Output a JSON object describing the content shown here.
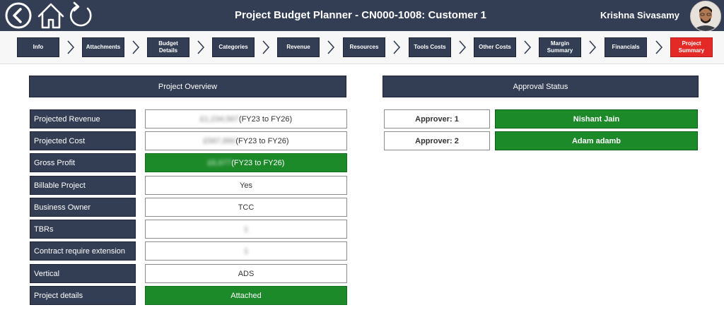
{
  "header": {
    "title": "Project Budget Planner - CN000-1008: Customer 1",
    "user_name": "Krishna Sivasamy",
    "bar_color": "#333d54"
  },
  "steps": [
    {
      "label": "Info",
      "active": false
    },
    {
      "label": "Attachments",
      "active": false
    },
    {
      "label": "Budget Details",
      "active": false
    },
    {
      "label": "Categories",
      "active": false
    },
    {
      "label": "Revenue",
      "active": false
    },
    {
      "label": "Resources",
      "active": false
    },
    {
      "label": "Tools Costs",
      "active": false
    },
    {
      "label": "Other Costs",
      "active": false
    },
    {
      "label": "Margin Summary",
      "active": false
    },
    {
      "label": "Financials",
      "active": false
    },
    {
      "label": "Project Summary",
      "active": true
    }
  ],
  "overview": {
    "header": "Project Overview",
    "rows": [
      {
        "label": "Projected Revenue",
        "value_blurred": "£1,234,567",
        "value_suffix": "(FY23 to FY26)",
        "style": "plain"
      },
      {
        "label": "Projected Cost",
        "value_blurred": "£567,890",
        "value_suffix": "(FY23 to FY26)",
        "style": "plain"
      },
      {
        "label": "Gross Profit",
        "value_blurred": "£6,677",
        "value_suffix": "(FY23 to FY26)",
        "style": "green"
      },
      {
        "label": "Billable Project",
        "value": "Yes",
        "style": "plain"
      },
      {
        "label": "Business Owner",
        "value": "TCC",
        "style": "plain"
      },
      {
        "label": "TBRs",
        "value_blurred": "1",
        "style": "plain"
      },
      {
        "label": "Contract require extension",
        "value_blurred": "1",
        "style": "plain"
      },
      {
        "label": "Vertical",
        "value": "ADS",
        "style": "plain"
      },
      {
        "label": "Project details",
        "value": "Attached",
        "style": "green"
      }
    ]
  },
  "approval": {
    "header": "Approval Status",
    "approvers": [
      {
        "label": "Approver: 1",
        "name": "Nishant Jain"
      },
      {
        "label": "Approver: 2",
        "name": "Adam adamb"
      }
    ]
  },
  "colors": {
    "accent_green": "#1d8a2a",
    "active_step_red": "#e32a27"
  },
  "icons": [
    "back-arrow-icon",
    "home-icon",
    "refresh-icon",
    "chevron-right-icon"
  ]
}
